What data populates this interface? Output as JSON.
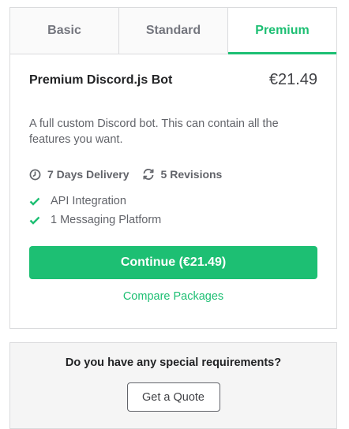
{
  "tabs": [
    {
      "label": "Basic"
    },
    {
      "label": "Standard"
    },
    {
      "label": "Premium"
    }
  ],
  "package": {
    "title": "Premium Discord.js Bot",
    "price": "€21.49",
    "description": "A full custom Discord bot. This can contain all the features you want.",
    "delivery": "7 Days Delivery",
    "revisions": "5 Revisions",
    "features": [
      "API Integration",
      "1 Messaging Platform"
    ],
    "continue_label": "Continue (€21.49)",
    "compare_label": "Compare Packages"
  },
  "quote": {
    "question": "Do you have any special requirements?",
    "button_label": "Get a Quote"
  },
  "colors": {
    "accent": "#1dbf73",
    "text": "#404145",
    "muted": "#62646a"
  }
}
